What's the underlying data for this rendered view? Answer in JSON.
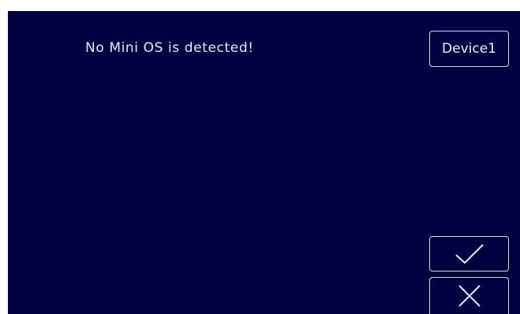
{
  "dialog": {
    "message": "No Mini OS is detected!",
    "device_button_label": "Device1"
  },
  "actions": {
    "confirm_icon": "checkmark-icon",
    "cancel_icon": "x-icon"
  },
  "colors": {
    "background": "#010040",
    "text": "#e8e8f4",
    "border": "#d8d8e8"
  }
}
